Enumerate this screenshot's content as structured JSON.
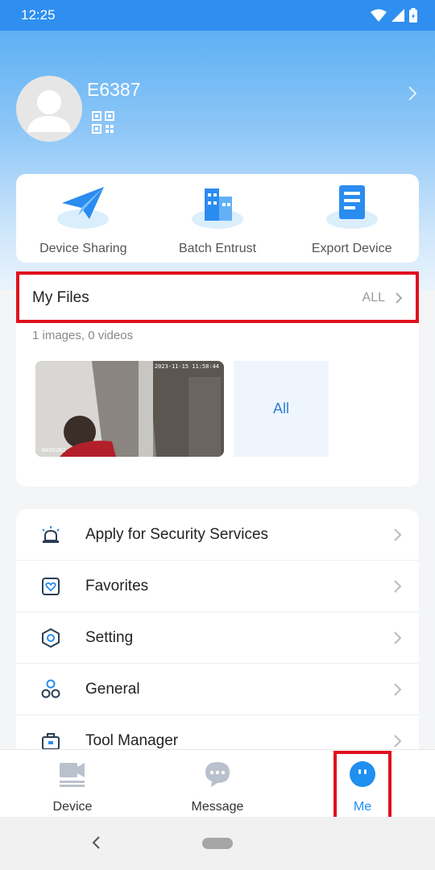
{
  "status_bar": {
    "time": "12:25"
  },
  "profile": {
    "username": "E6387"
  },
  "quick_actions": [
    {
      "label": "Device Sharing",
      "icon": "paper-plane-icon"
    },
    {
      "label": "Batch Entrust",
      "icon": "buildings-icon"
    },
    {
      "label": "Export Device",
      "icon": "document-icon"
    }
  ],
  "files": {
    "title": "My Files",
    "all_label": "ALL",
    "summary": "1 images, 0 videos",
    "thumb_timestamp": "2023-11-15 11:58:44",
    "thumb_caption": "N45EU62",
    "all_tile": "All"
  },
  "menu": [
    {
      "label": "Apply for Security Services",
      "icon": "alarm-light-icon"
    },
    {
      "label": "Favorites",
      "icon": "heart-box-icon"
    },
    {
      "label": "Setting",
      "icon": "hexagon-gear-icon"
    },
    {
      "label": "General",
      "icon": "hexagons-cluster-icon"
    },
    {
      "label": "Tool Manager",
      "icon": "toolbox-icon"
    }
  ],
  "tabs": [
    {
      "label": "Device",
      "icon": "video-device-icon"
    },
    {
      "label": "Message",
      "icon": "chat-bubble-icon"
    },
    {
      "label": "Me",
      "icon": "me-face-icon",
      "active": true
    }
  ],
  "colors": {
    "accent": "#1f8ff0",
    "highlight": "#e0101e"
  }
}
